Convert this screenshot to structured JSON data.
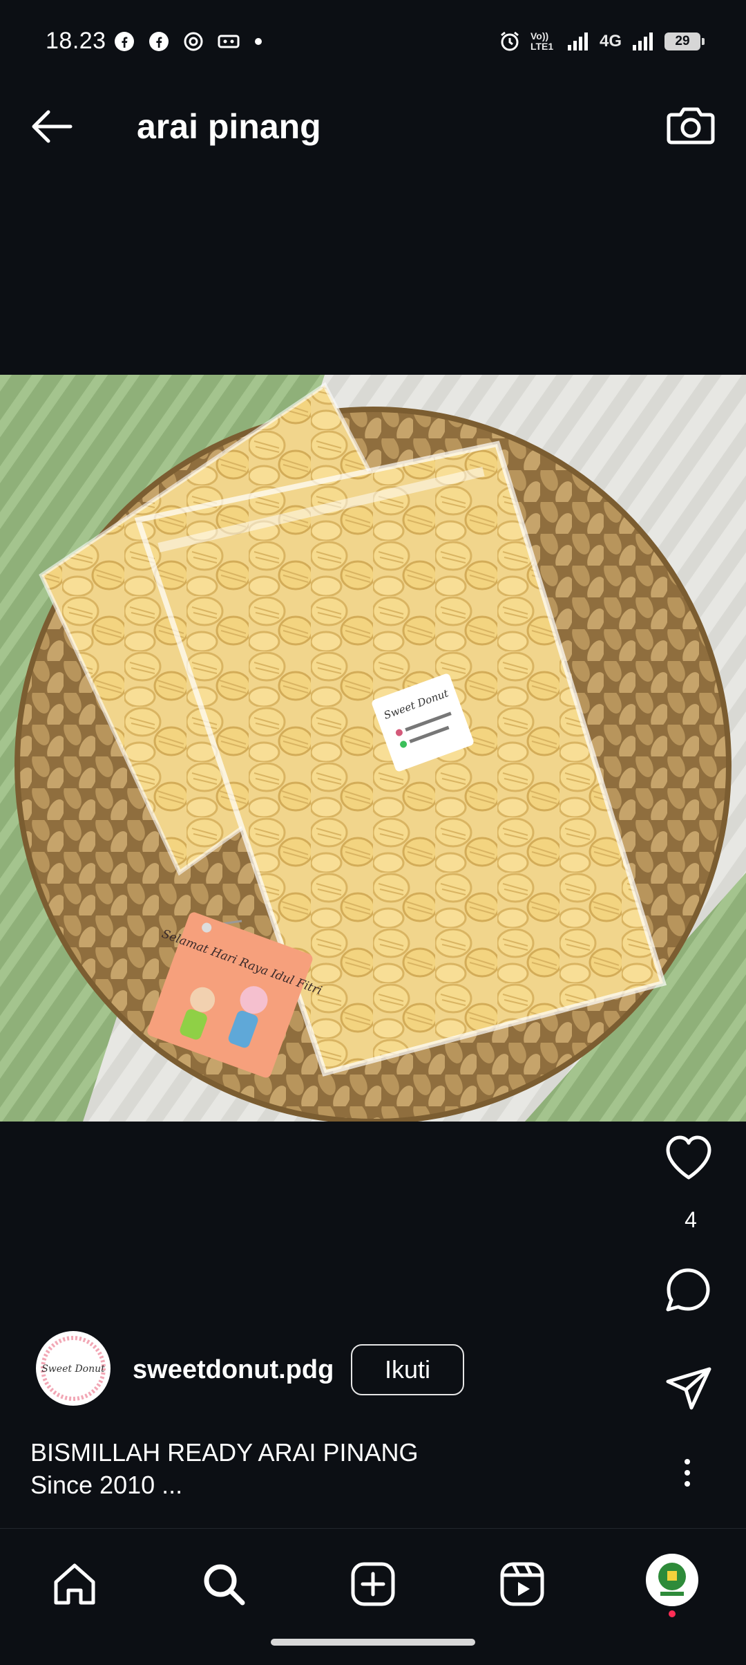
{
  "status_bar": {
    "time": "18.23",
    "left_icons": [
      "facebook-icon",
      "facebook-icon",
      "threads-icon",
      "tape-icon",
      "dot-icon"
    ],
    "volte_label": "Vo)) LTE1",
    "network_label": "4G",
    "battery": "29"
  },
  "app_bar": {
    "title": "arai pinang",
    "back_icon": "arrow-left-icon",
    "camera_icon": "camera-icon"
  },
  "media": {
    "bag_sticker_text": "Sweet Donut",
    "tag_text": "Selamat Hari Raya Idul Fitri"
  },
  "actions": {
    "like_icon": "heart-icon",
    "like_count": "4",
    "comment_icon": "comment-icon",
    "share_icon": "send-icon",
    "more_icon": "more-vertical-icon"
  },
  "post": {
    "avatar_text": "Sweet Donut",
    "username": "sweetdonut.pdg",
    "follow_label": "Ikuti",
    "caption_line1": "BISMILLAH READY ARAI PINANG",
    "caption_line2": "Since 2010 ..."
  },
  "bottom_nav": {
    "items": [
      "home-icon",
      "search-icon",
      "create-icon",
      "reels-icon",
      "profile-avatar"
    ]
  },
  "colors": {
    "background": "#0c0f14",
    "text": "#ffffff",
    "notify": "#ff2d55"
  }
}
